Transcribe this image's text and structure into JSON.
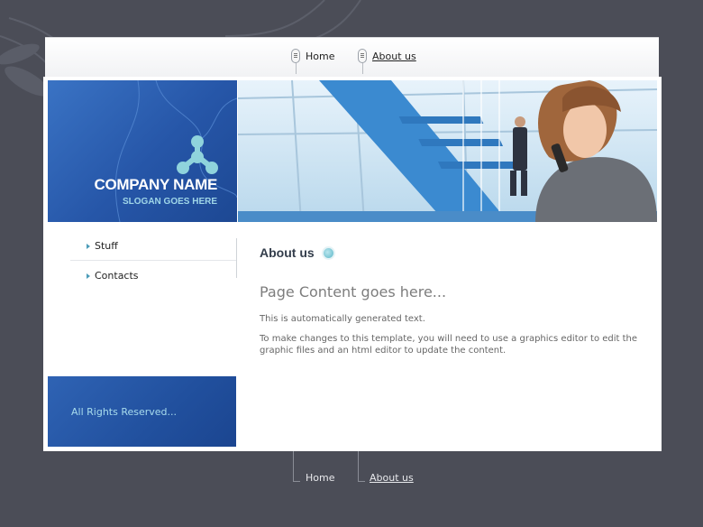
{
  "top_nav": [
    {
      "label": "Home"
    },
    {
      "label": "About us"
    }
  ],
  "brand": {
    "company_name": "COMPANY NAME",
    "slogan": "SLOGAN GOES HERE"
  },
  "sidebar": {
    "items": [
      {
        "label": "Stuff"
      },
      {
        "label": "Contacts"
      }
    ],
    "footer_text": "All Rights Reserved..."
  },
  "main": {
    "section_title": "About us",
    "content_heading": "Page Content goes here...",
    "paragraphs": [
      "This is automatically generated text.",
      "To make changes to this template, you will need to use a graphics editor to edit the graphic files and an html editor to update the content."
    ]
  },
  "bottom_nav": [
    {
      "label": "Home"
    },
    {
      "label": "About us"
    }
  ],
  "colors": {
    "page_background": "#4b4d57",
    "brand_blue": "#2656a8",
    "slogan_cyan": "#9fd6e8"
  }
}
